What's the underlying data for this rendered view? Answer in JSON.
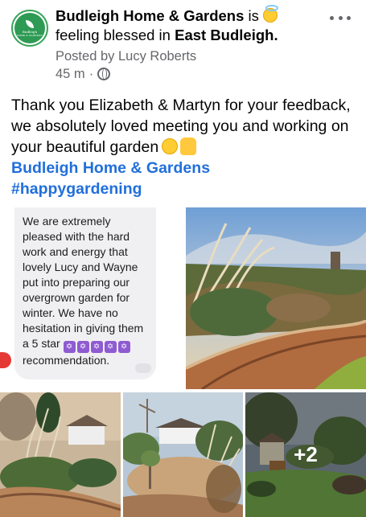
{
  "post": {
    "page_name": "Budleigh Home & Gardens",
    "is_text": "is",
    "feeling_text": "feeling blessed in",
    "location": "East Budleigh.",
    "posted_by": "Posted by Lucy Roberts",
    "time": "45 m",
    "dot": "·",
    "body_text": "Thank you Elizabeth & Martyn for your feedback, we absolutely loved meeting you and working on your beautiful garden",
    "mention": "Budleigh Home & Gardens",
    "hashtag": "#happygardening"
  },
  "avatar": {
    "brand_line1": "Budleigh",
    "brand_line2": "HOME & GARDENS"
  },
  "review": {
    "text_before_stars": "We are extremely pleased with the hard work and energy that lovely Lucy and Wayne put into preparing our overgrown garden for winter. We have no hesitation in giving them a 5 star",
    "text_after_stars": "recommendation.",
    "star_glyph": "✡",
    "star_count": 5
  },
  "photos": {
    "more_count": "+2"
  },
  "icons": {
    "globe": "globe-icon",
    "more": "more-options-icon",
    "angel_emoji": "smiling-face-with-halo-emoji",
    "smile_emoji": "smiling-face-emoji",
    "thumb_emoji": "thumbs-up-emoji"
  },
  "colors": {
    "link": "#216fdb",
    "secondary_text": "#65676b",
    "brand_green": "#2e9a54"
  }
}
